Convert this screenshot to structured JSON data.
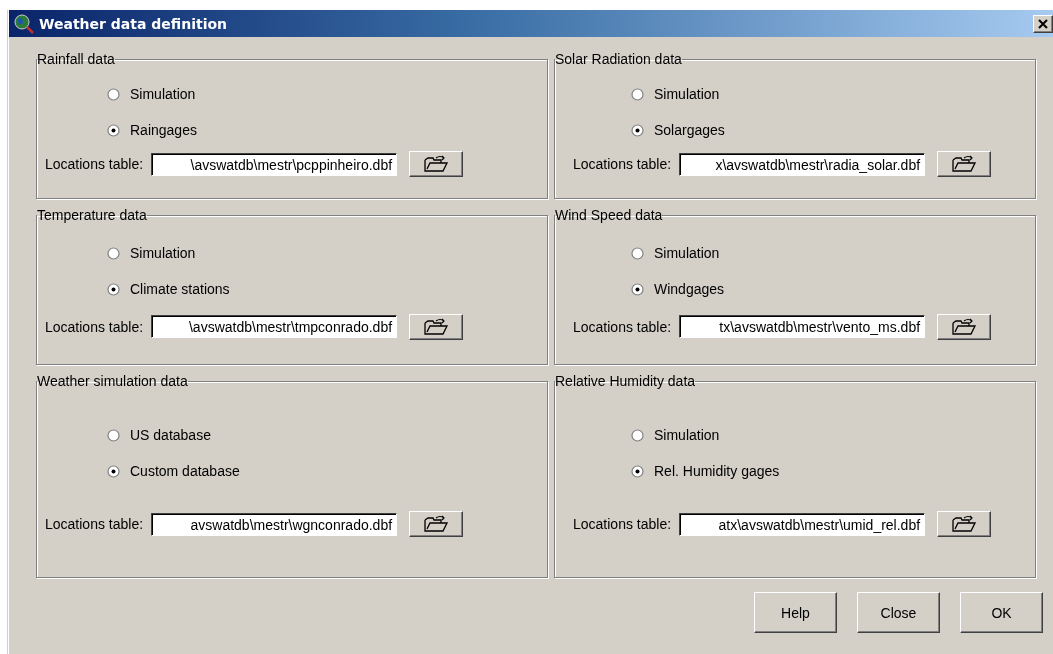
{
  "window": {
    "title": "Weather data definition"
  },
  "groups": [
    {
      "title": "Rainfall data",
      "options": [
        {
          "label": "Simulation",
          "selected": false
        },
        {
          "label": "Raingages",
          "selected": true
        }
      ],
      "locations_label": "Locations table:",
      "locations_value": "\\avswatdb\\mestr\\pcppinheiro.dbf"
    },
    {
      "title": "Solar Radiation data",
      "options": [
        {
          "label": "Simulation",
          "selected": false
        },
        {
          "label": "Solargages",
          "selected": true
        }
      ],
      "locations_label": "Locations table:",
      "locations_value": "x\\avswatdb\\mestr\\radia_solar.dbf"
    },
    {
      "title": "Temperature data",
      "options": [
        {
          "label": "Simulation",
          "selected": false
        },
        {
          "label": "Climate stations",
          "selected": true
        }
      ],
      "locations_label": "Locations table:",
      "locations_value": "\\avswatdb\\mestr\\tmpconrado.dbf"
    },
    {
      "title": "Wind Speed data",
      "options": [
        {
          "label": "Simulation",
          "selected": false
        },
        {
          "label": "Windgages",
          "selected": true
        }
      ],
      "locations_label": "Locations table:",
      "locations_value": "tx\\avswatdb\\mestr\\vento_ms.dbf"
    },
    {
      "title": "Weather simulation data",
      "options": [
        {
          "label": "US database",
          "selected": false
        },
        {
          "label": "Custom database",
          "selected": true
        }
      ],
      "locations_label": "Locations table:",
      "locations_value": "avswatdb\\mestr\\wgnconrado.dbf"
    },
    {
      "title": "Relative Humidity data",
      "options": [
        {
          "label": "Simulation",
          "selected": false
        },
        {
          "label": "Rel. Humidity gages",
          "selected": true
        }
      ],
      "locations_label": "Locations table:",
      "locations_value": "atx\\avswatdb\\mestr\\umid_rel.dbf"
    }
  ],
  "buttons": [
    "Help",
    "Close",
    "OK"
  ]
}
